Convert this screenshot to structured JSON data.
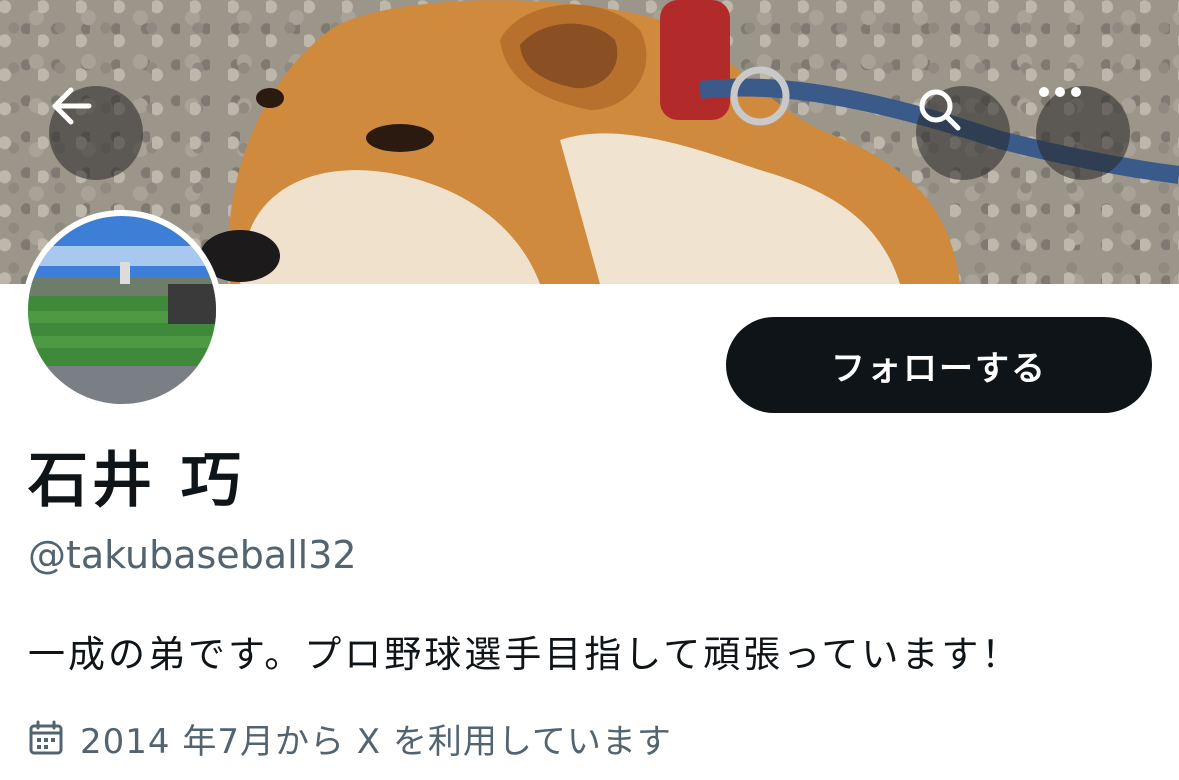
{
  "header": {
    "back_icon": "arrow-left-icon",
    "search_icon": "search-icon",
    "more_icon": "more-horizontal-icon"
  },
  "profile": {
    "follow_label": "フォローする",
    "display_name": "石井 巧",
    "handle": "@takubaseball32",
    "bio": "一成の弟です。プロ野球選手目指して頑張っています！",
    "joined_icon": "calendar-icon",
    "joined_text": "2014 年7月から X を利用しています"
  },
  "colors": {
    "follow_button_bg": "#0f1419",
    "secondary_text": "#536471",
    "primary_text": "#0f1419"
  }
}
